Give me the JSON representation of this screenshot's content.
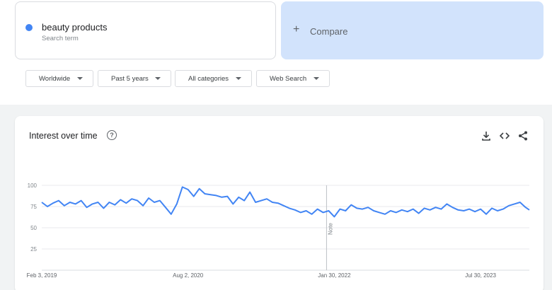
{
  "search_term": {
    "title": "beauty products",
    "subtitle": "Search term",
    "color": "#4285f4"
  },
  "compare": {
    "plus": "+",
    "label": "Compare"
  },
  "filters": [
    {
      "label": "Worldwide"
    },
    {
      "label": "Past 5 years"
    },
    {
      "label": "All categories"
    },
    {
      "label": "Web Search"
    }
  ],
  "chart_panel": {
    "title": "Interest over time",
    "help_glyph": "?",
    "icons": [
      "download-icon",
      "embed-icon",
      "share-icon"
    ],
    "note_label": "Note"
  },
  "chart_data": {
    "type": "line",
    "title": "Interest over time",
    "xlabel": "",
    "ylabel": "",
    "ylim": [
      0,
      100
    ],
    "y_ticks": [
      100,
      75,
      50,
      25
    ],
    "x_range": [
      "2019-02-03",
      "2024-01-28"
    ],
    "x_ticks": [
      {
        "label": "Feb 3, 2019",
        "date": "2019-02-03"
      },
      {
        "label": "Aug 2, 2020",
        "date": "2020-08-02"
      },
      {
        "label": "Jan 30, 2022",
        "date": "2022-01-30"
      },
      {
        "label": "Jul 30, 2023",
        "date": "2023-07-30"
      }
    ],
    "note_date": "2022-01-01",
    "grid": true,
    "legend": "none",
    "series": [
      {
        "color": "#4285f4",
        "points": [
          [
            "2019-02-03",
            80
          ],
          [
            "2019-02-24",
            75
          ],
          [
            "2019-03-17",
            79
          ],
          [
            "2019-04-07",
            82
          ],
          [
            "2019-04-28",
            76
          ],
          [
            "2019-05-19",
            80
          ],
          [
            "2019-06-09",
            78
          ],
          [
            "2019-06-30",
            82
          ],
          [
            "2019-07-21",
            74
          ],
          [
            "2019-08-11",
            78
          ],
          [
            "2019-09-01",
            80
          ],
          [
            "2019-09-22",
            73
          ],
          [
            "2019-10-13",
            80
          ],
          [
            "2019-11-03",
            77
          ],
          [
            "2019-11-24",
            83
          ],
          [
            "2019-12-15",
            79
          ],
          [
            "2020-01-05",
            84
          ],
          [
            "2020-01-26",
            82
          ],
          [
            "2020-02-16",
            76
          ],
          [
            "2020-03-08",
            85
          ],
          [
            "2020-03-29",
            80
          ],
          [
            "2020-04-19",
            82
          ],
          [
            "2020-05-10",
            74
          ],
          [
            "2020-05-31",
            66
          ],
          [
            "2020-06-21",
            78
          ],
          [
            "2020-07-12",
            98
          ],
          [
            "2020-08-02",
            95
          ],
          [
            "2020-08-23",
            87
          ],
          [
            "2020-09-13",
            96
          ],
          [
            "2020-10-04",
            90
          ],
          [
            "2020-10-25",
            89
          ],
          [
            "2020-11-15",
            88
          ],
          [
            "2020-12-06",
            86
          ],
          [
            "2020-12-27",
            87
          ],
          [
            "2021-01-17",
            78
          ],
          [
            "2021-02-07",
            86
          ],
          [
            "2021-02-28",
            82
          ],
          [
            "2021-03-21",
            92
          ],
          [
            "2021-04-11",
            80
          ],
          [
            "2021-05-02",
            82
          ],
          [
            "2021-05-23",
            84
          ],
          [
            "2021-06-13",
            80
          ],
          [
            "2021-07-04",
            79
          ],
          [
            "2021-07-25",
            76
          ],
          [
            "2021-08-15",
            73
          ],
          [
            "2021-09-05",
            71
          ],
          [
            "2021-09-26",
            68
          ],
          [
            "2021-10-17",
            70
          ],
          [
            "2021-11-07",
            66
          ],
          [
            "2021-11-28",
            72
          ],
          [
            "2021-12-19",
            68
          ],
          [
            "2022-01-09",
            70
          ],
          [
            "2022-01-30",
            63
          ],
          [
            "2022-02-20",
            72
          ],
          [
            "2022-03-13",
            70
          ],
          [
            "2022-04-03",
            77
          ],
          [
            "2022-04-24",
            73
          ],
          [
            "2022-05-15",
            72
          ],
          [
            "2022-06-05",
            74
          ],
          [
            "2022-06-26",
            70
          ],
          [
            "2022-07-17",
            68
          ],
          [
            "2022-08-07",
            66
          ],
          [
            "2022-08-28",
            70
          ],
          [
            "2022-09-18",
            68
          ],
          [
            "2022-10-09",
            71
          ],
          [
            "2022-10-30",
            69
          ],
          [
            "2022-11-20",
            72
          ],
          [
            "2022-12-11",
            67
          ],
          [
            "2023-01-01",
            73
          ],
          [
            "2023-01-22",
            71
          ],
          [
            "2023-02-12",
            74
          ],
          [
            "2023-03-05",
            72
          ],
          [
            "2023-03-26",
            78
          ],
          [
            "2023-04-16",
            74
          ],
          [
            "2023-05-07",
            71
          ],
          [
            "2023-05-28",
            70
          ],
          [
            "2023-06-18",
            72
          ],
          [
            "2023-07-09",
            69
          ],
          [
            "2023-07-30",
            72
          ],
          [
            "2023-08-20",
            66
          ],
          [
            "2023-09-10",
            73
          ],
          [
            "2023-10-01",
            70
          ],
          [
            "2023-10-22",
            72
          ],
          [
            "2023-11-12",
            76
          ],
          [
            "2023-12-03",
            78
          ],
          [
            "2023-12-24",
            80
          ],
          [
            "2024-01-14",
            74
          ],
          [
            "2024-01-28",
            71
          ]
        ]
      }
    ]
  }
}
